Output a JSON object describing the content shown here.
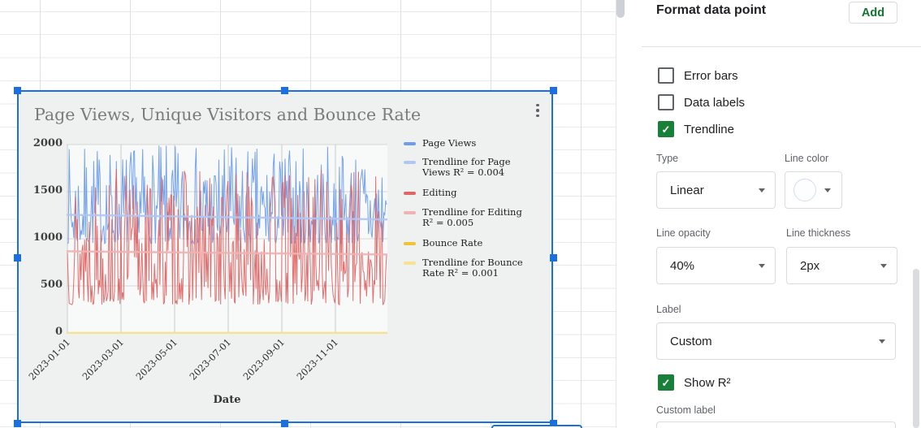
{
  "panel": {
    "title": "Format data point",
    "add_button_label": "Add",
    "checkboxes": [
      {
        "label": "Error bars",
        "checked": false
      },
      {
        "label": "Data labels",
        "checked": false
      },
      {
        "label": "Trendline",
        "checked": true
      }
    ],
    "type_label": "Type",
    "type_value": "Linear",
    "line_color_label": "Line color",
    "line_opacity_label": "Line opacity",
    "line_opacity_value": "40%",
    "line_thickness_label": "Line thickness",
    "line_thickness_value": "2px",
    "label_label": "Label",
    "label_value": "Custom",
    "show_r2": {
      "label": "Show R²",
      "checked": true
    },
    "custom_label_label": "Custom label",
    "colors": {
      "accent_green": "#137333",
      "checkbox_green": "#188038",
      "selection_blue": "#1b6fe0"
    }
  },
  "chart_data": {
    "type": "line",
    "title": "Page Views, Unique Visitors and Bounce Rate",
    "xlabel": "Date",
    "x_ticks": [
      "2023-01-01",
      "2023-03-01",
      "2023-05-01",
      "2023-07-01",
      "2023-09-01",
      "2023-11-01"
    ],
    "y_ticks": [
      0,
      500,
      1000,
      1500,
      2000
    ],
    "ylim": [
      0,
      2000
    ],
    "x_span_days": 353,
    "grid": true,
    "legend_position": "right",
    "series": [
      {
        "name": "Page Views",
        "color": "#6d9eeb",
        "pattern": "random daily values",
        "approx_min": 950,
        "approx_max": 2000,
        "approx_mean": 1230
      },
      {
        "name": "Editing",
        "color": "#e06666",
        "pattern": "random daily values",
        "approx_min": 300,
        "approx_max": 1750,
        "approx_mean": 850
      },
      {
        "name": "Bounce Rate",
        "color": "#f1c232",
        "pattern": "flat near zero",
        "approx_min": 0,
        "approx_max": 1,
        "approx_mean": 0.5
      }
    ],
    "trendlines": [
      {
        "label": "Trendline for Page Views R² = 0.004",
        "for": "Page Views",
        "color": "#b3c6f2",
        "value": 1230,
        "r2": 0.004
      },
      {
        "label": "Trendline for Editing R² = 0.005",
        "for": "Editing",
        "color": "#efb3b3",
        "value": 850,
        "r2": 0.005
      },
      {
        "label": "Trendline for Bounce Rate R² = 0.001",
        "for": "Bounce Rate",
        "color": "#f7e294",
        "value": 0.5,
        "r2": 0.001
      }
    ],
    "legend": [
      {
        "label": "Page Views",
        "color": "#6d9eeb"
      },
      {
        "label": "Trendline for Page Views R² = 0.004",
        "color": "#b3c6f2"
      },
      {
        "label": "Editing",
        "color": "#e06666"
      },
      {
        "label": "Trendline for Editing R² = 0.005",
        "color": "#efb3b3"
      },
      {
        "label": "Bounce Rate",
        "color": "#f1c232"
      },
      {
        "label": "Trendline for Bounce Rate R² = 0.001",
        "color": "#f7e294"
      }
    ]
  }
}
